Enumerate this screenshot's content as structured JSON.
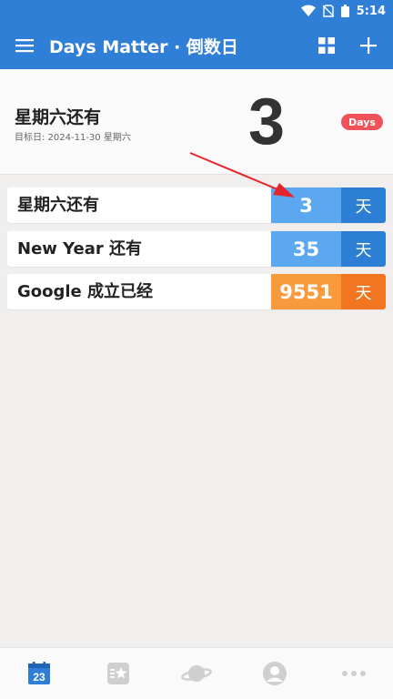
{
  "status_bar": {
    "time": "5:14",
    "icons": [
      "wifi-icon",
      "no-sim-icon",
      "battery-icon"
    ]
  },
  "app_bar": {
    "title": "Days Matter · 倒数日",
    "actions": [
      "menu-icon",
      "grid-icon",
      "add-icon"
    ]
  },
  "hero": {
    "title": "星期六还有",
    "target_date": "目标日: 2024-11-30 星期六",
    "count": "3",
    "badge": "Days"
  },
  "events": [
    {
      "label": "星期六还有",
      "count": "3",
      "unit": "天",
      "num_color": "#5ba8f0",
      "unit_color": "#2d7fd4"
    },
    {
      "label": "New Year 还有",
      "count": "35",
      "unit": "天",
      "num_color": "#5ba8f0",
      "unit_color": "#2d7fd4"
    },
    {
      "label": "Google 成立已经",
      "count": "9551",
      "unit": "天",
      "num_color": "#f99a3c",
      "unit_color": "#f27621"
    }
  ],
  "bottom_nav": {
    "calendar_day": "23",
    "tabs": [
      "calendar-icon",
      "starred-list-icon",
      "planet-icon",
      "profile-icon",
      "more-icon"
    ]
  },
  "colors": {
    "primary": "#2f7fd6",
    "badge": "#f0525a",
    "annotation_arrow": "#e8242a"
  }
}
